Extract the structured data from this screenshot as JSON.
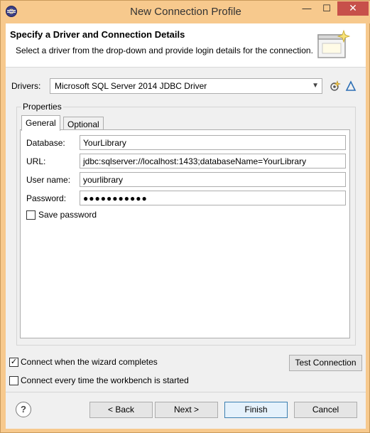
{
  "window": {
    "title": "New Connection Profile",
    "minimize_label": "—",
    "maximize_label": "☐",
    "close_label": "✕"
  },
  "header": {
    "title": "Specify a Driver and Connection Details",
    "description": "Select a driver from the drop-down and provide login details for the connection."
  },
  "drivers": {
    "label": "Drivers:",
    "selected": "Microsoft SQL Server 2014 JDBC Driver",
    "new_driver_icon": "new-driver-icon",
    "edit_driver_icon": "edit-driver-icon"
  },
  "properties": {
    "legend": "Properties",
    "tabs": [
      {
        "label": "General",
        "active": true
      },
      {
        "label": "Optional",
        "active": false
      }
    ],
    "fields": {
      "database_label": "Database:",
      "database_value": "YourLibrary",
      "url_label": "URL:",
      "url_value": "jdbc:sqlserver://localhost:1433;databaseName=YourLibrary",
      "username_label": "User name:",
      "username_value": "yourlibrary",
      "password_label": "Password:",
      "password_value": "●●●●●●●●●●●"
    },
    "save_password_label": "Save password",
    "save_password_checked": false
  },
  "options": {
    "connect_when_complete_label": "Connect when the wizard completes",
    "connect_when_complete_checked": true,
    "connect_every_time_label": "Connect every time the workbench is started",
    "connect_every_time_checked": false,
    "test_connection_label": "Test Connection"
  },
  "footer": {
    "help_label": "?",
    "back_label": "< Back",
    "next_label": "Next >",
    "finish_label": "Finish",
    "cancel_label": "Cancel"
  },
  "colors": {
    "titlebar": "#f7c98d",
    "close_button": "#c7504a",
    "default_button_border": "#3c7fb1"
  }
}
